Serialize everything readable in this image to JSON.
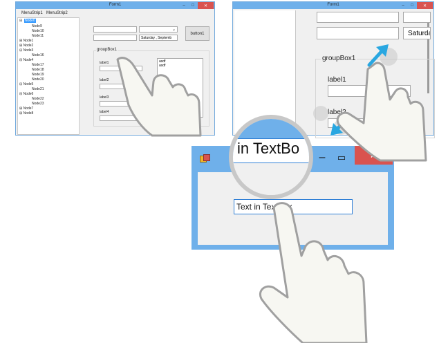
{
  "win1": {
    "title": "Form1",
    "menu": [
      "MenuStrip1",
      "MenuStrip2"
    ],
    "tree": {
      "root": "Node0",
      "items": [
        "Node9",
        "Node10",
        "Node11",
        "Node1",
        "Node2",
        "Node3",
        "Node16",
        "Node4",
        "Node17",
        "Node18",
        "Node19",
        "Node20",
        "Node5",
        "Node21",
        "Node6",
        "Node22",
        "Node23",
        "Node7",
        "Node8"
      ]
    },
    "date_value": "Saturday , Septemb",
    "button1": "button1",
    "groupbox": "groupBox1",
    "labels": [
      "label1",
      "label2",
      "label3",
      "label4"
    ],
    "listbox": [
      "asdf",
      "asdf"
    ]
  },
  "win2": {
    "title": "Form1",
    "date_value": "Saturday",
    "groupbox": "groupBox1",
    "label1": "label1",
    "label2": "label2"
  },
  "win3": {
    "textbox_value": "Text in TextBox",
    "magnified_text": "in TextBo"
  },
  "colors": {
    "title_blue": "#6fb0ea",
    "close_red": "#d9534f",
    "arrow_blue": "#29a7e1"
  },
  "icons": [
    "minimize-icon",
    "maximize-icon",
    "close-icon",
    "app-icon",
    "arrow-up-right-icon",
    "arrow-down-left-icon",
    "tap-hand-icon"
  ]
}
